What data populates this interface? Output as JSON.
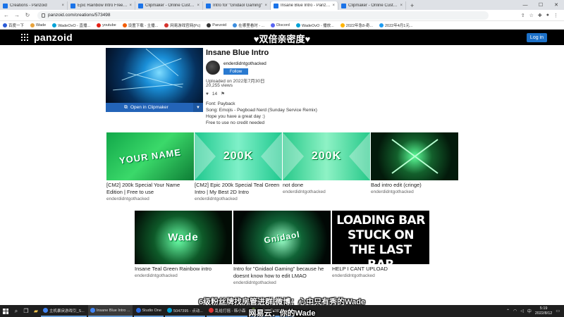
{
  "browser": {
    "tabs": [
      {
        "label": "Creations - Panzoid",
        "active": false
      },
      {
        "label": "Epic Rainbow Intro Free Tem...",
        "active": false
      },
      {
        "label": "Clipmaker - Online Custom...",
        "active": false
      },
      {
        "label": "Intro for \"Gnidaol Gaming\"",
        "active": false
      },
      {
        "label": "Insane Blue Intro - Panzoid",
        "active": true
      },
      {
        "label": "Clipmaker - Online Custom...",
        "active": false
      }
    ],
    "url": "panzoid.com/creations/573498",
    "bookmarks": [
      "百度一下",
      "Wade",
      "WadeOvO - 直播...",
      "youtube",
      "设置下载 - 主播...",
      "网易游戏官网(Pc)",
      "Panzoid",
      "在哪里看时 - ...",
      "Discord",
      "WadeOvO - 播放...",
      "2022年急8-奇...",
      "2022年4月1元..."
    ]
  },
  "site": {
    "logo": "panzoid",
    "overlay_title": "♥双倍亲密度♥",
    "login_label": "Log in"
  },
  "creation": {
    "title": "Insane Blue Intro",
    "author": "enderdidntgothacked",
    "follow_label": "Follow",
    "uploaded": "Uploaded on 2022年7月30日",
    "views": "20,255 views",
    "likes": "14",
    "open_label": "Open in Clipmaker",
    "description": [
      "Font: Payback",
      "Song: Emojis - Pegboad Nerd (Sunday Service Remix)",
      "Hope you have a great day :)",
      "Free to use no credit needed"
    ]
  },
  "grid_row1": [
    {
      "title": "[CM2] 200k Special Your Name Edition | Free to use",
      "author": "enderdidntgothacked",
      "thumb_text": "YOUR NAME"
    },
    {
      "title": "[CM2] Epic 200k Special Teal Green Intro | My Best 2D Intro",
      "author": "enderdidntgothacked",
      "thumb_text": "200K"
    },
    {
      "title": "not done",
      "author": "enderdidntgothacked",
      "thumb_text": "200K"
    },
    {
      "title": "Bad intro edit (cringe)",
      "author": "enderdidntgothacked",
      "thumb_text": ""
    }
  ],
  "grid_row2": [
    {
      "title": "Insane Teal Green Rainbow intro",
      "author": "enderdidntgothacked",
      "thumb_text": "Wade"
    },
    {
      "title": "Intro for \"Gnidaol Gaming\" because he doesnt know how to edit LMAO",
      "author": "enderdidntgothacked",
      "thumb_text": "Gnidaol"
    },
    {
      "title": "HELP I CANT UPLOAD",
      "author": "enderdidntgothacked",
      "thumb_text": "LOADING BAR STUCK ON THE LAST BAR"
    }
  ],
  "subtitles": {
    "line1": "6级粉丝牌找房管进群    微博：心中只有秀的Wade",
    "line2": "网易云：你的Wade"
  },
  "taskbar": {
    "tasks": [
      {
        "label": "主机暴戾游戏引_S...",
        "active": false
      },
      {
        "label": "Insane Blue Intro ...",
        "active": true
      },
      {
        "label": "Studio One",
        "active": false
      },
      {
        "label": "5047395 - 点动...",
        "active": false
      },
      {
        "label": "乱给打摇 - 韩小森",
        "active": false
      },
      {
        "label": "梦飞千鸟(2831013...",
        "active": false
      }
    ],
    "time": "5:19",
    "date": "2022/8/12"
  },
  "colors": {
    "header_bg": "#000000",
    "brand_blue": "#2364b8",
    "login_blue": "#1c70c7"
  }
}
